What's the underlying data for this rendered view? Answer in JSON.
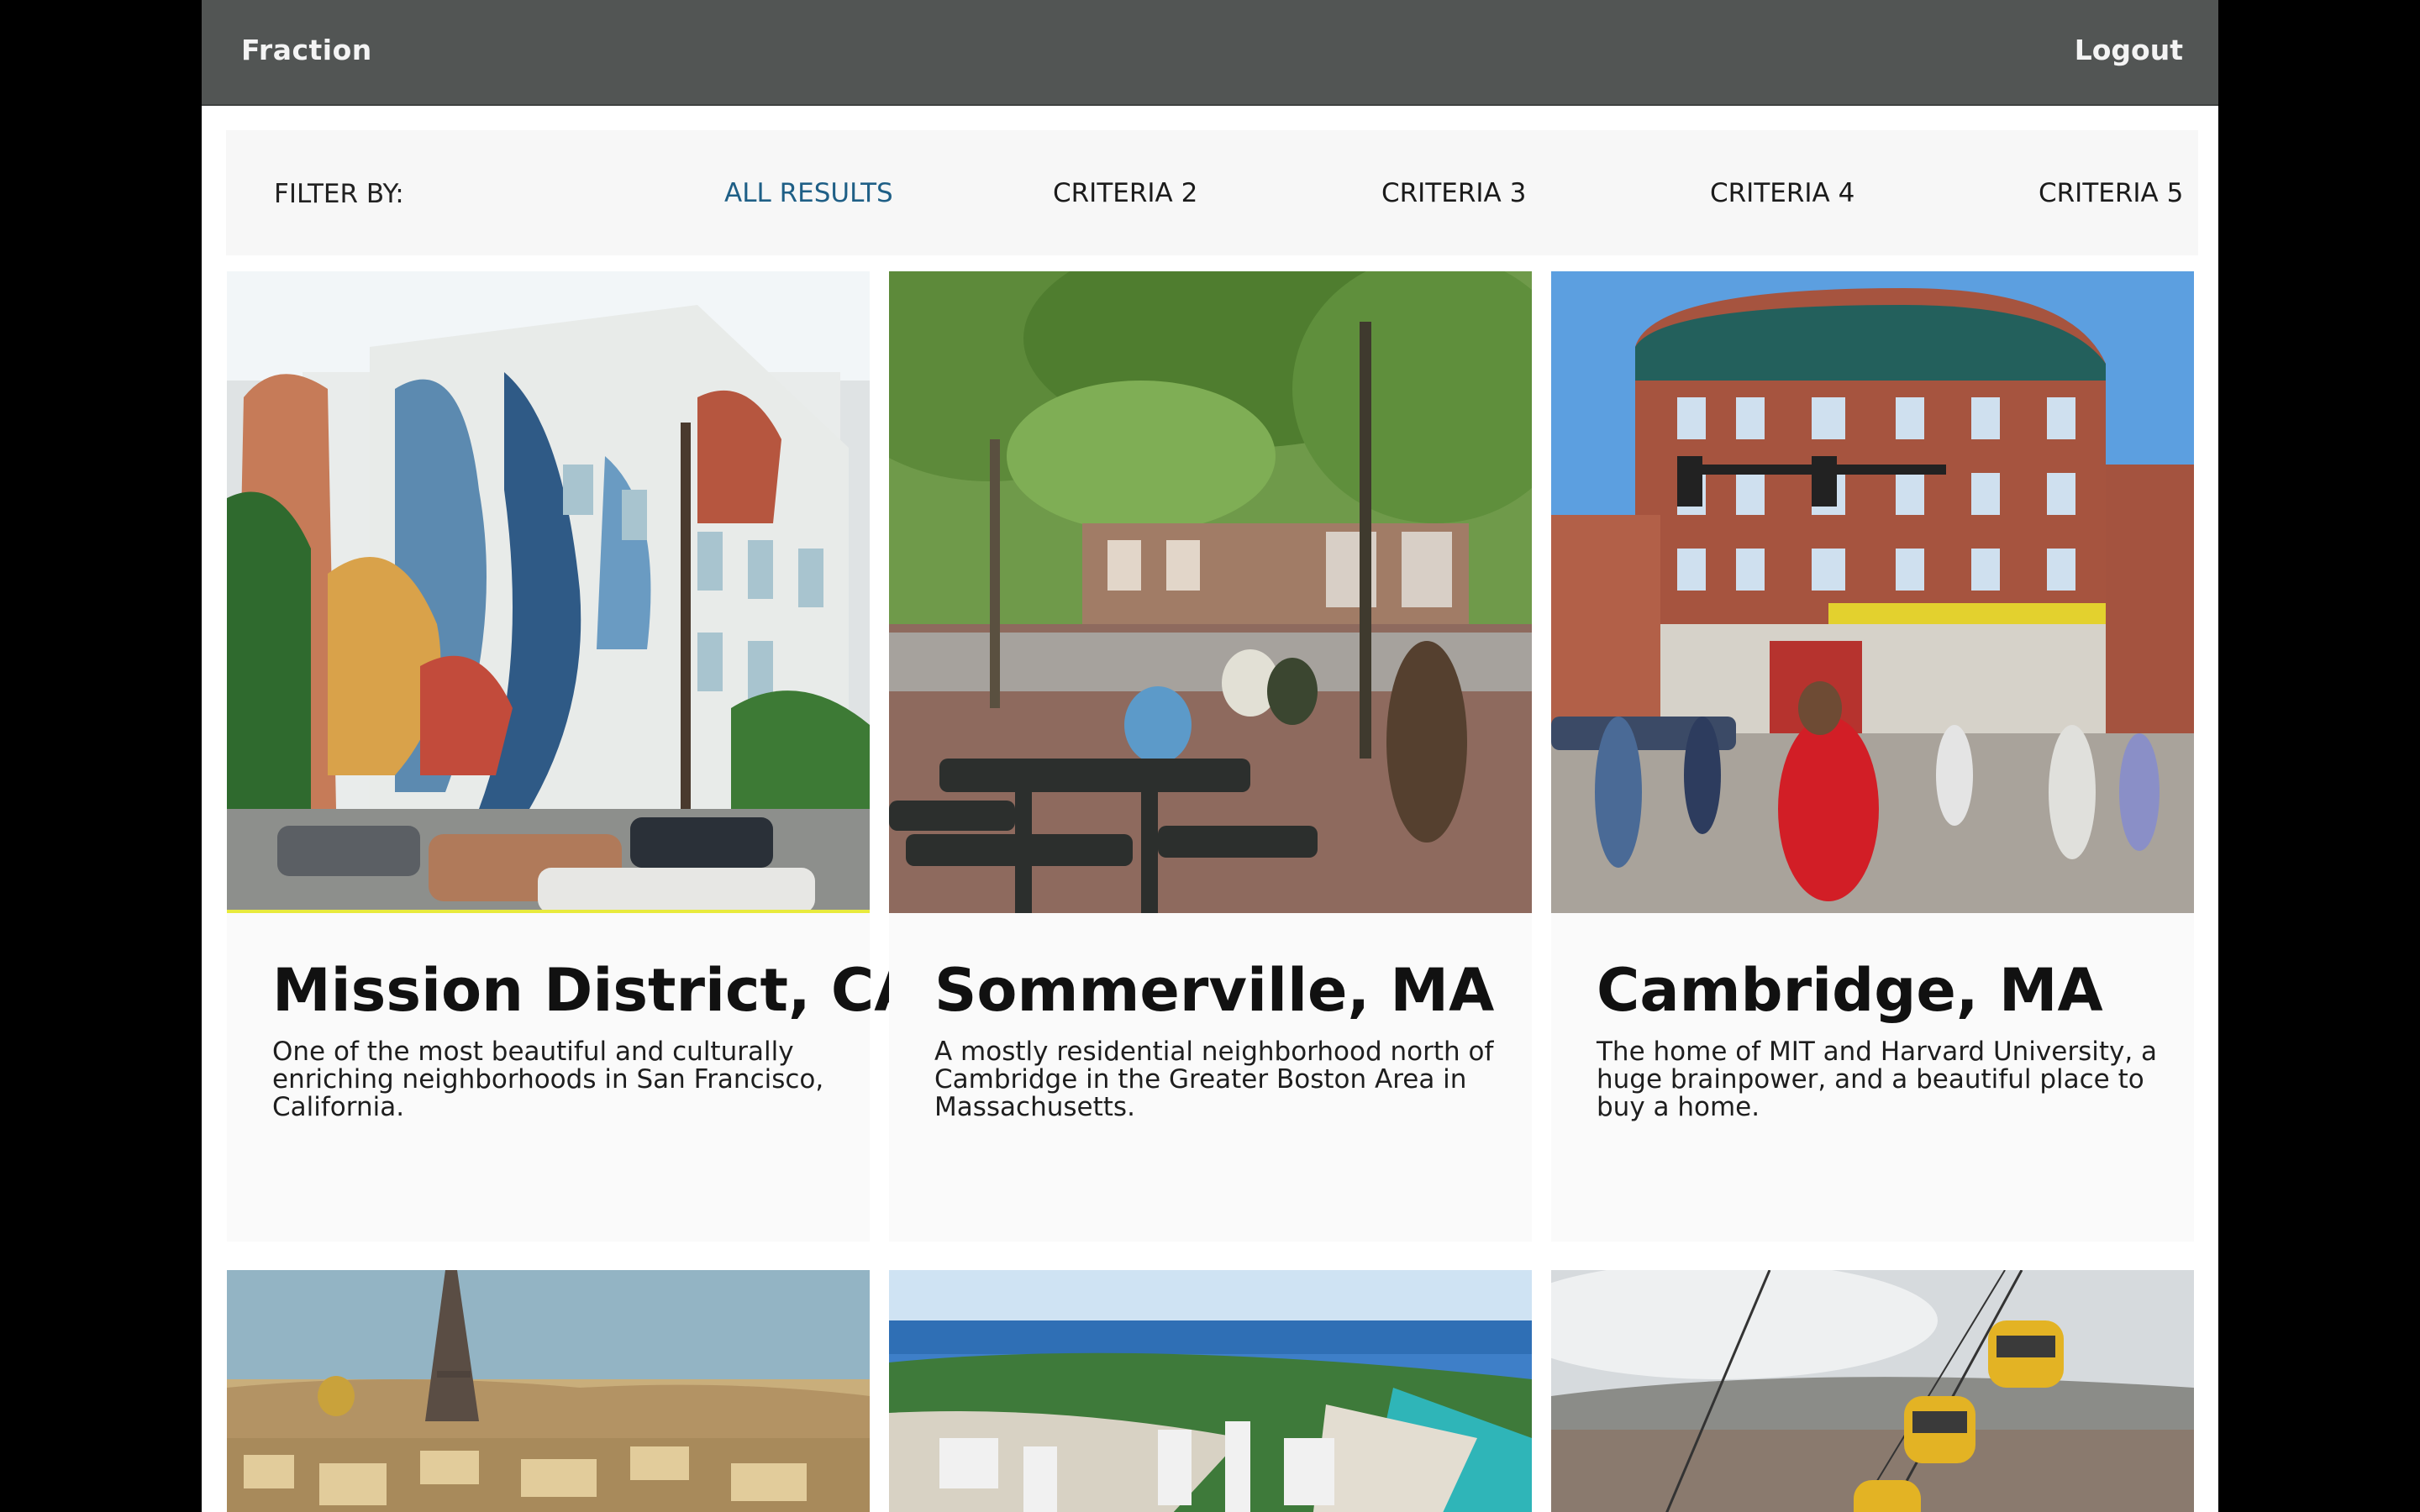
{
  "app": {
    "brand": "Fraction",
    "logout_label": "Logout"
  },
  "filter": {
    "label": "FILTER BY:",
    "options": [
      "ALL RESULTS",
      "CRITERIA 2",
      "CRITERIA 3",
      "CRITERIA 4",
      "CRITERIA 5"
    ],
    "active": "ALL RESULTS"
  },
  "listings": [
    {
      "title": "Mission District, CA",
      "description": "One of the most beautiful and culturally enriching neighborhoods in San Francisco, California.",
      "image": "mural-building-photo"
    },
    {
      "title": "Sommerville, MA",
      "description": "A mostly residential neighborhood north of Cambridge in the Greater Boston Area in Massachusetts.",
      "image": "tree-plaza-photo"
    },
    {
      "title": "Cambridge, MA",
      "description": "The home of MIT and Harvard University, a huge brainpower, and a beautiful place to buy a home.",
      "image": "brick-building-street-photo"
    },
    {
      "image": "paris-skyline-photo"
    },
    {
      "image": "miami-beach-aerial-photo"
    },
    {
      "image": "cable-car-city-photo"
    }
  ],
  "colors": {
    "topbar": "#525554",
    "active_filter": "#1f5f86",
    "card_bg": "#fafafa",
    "page_bg": "#000000"
  }
}
